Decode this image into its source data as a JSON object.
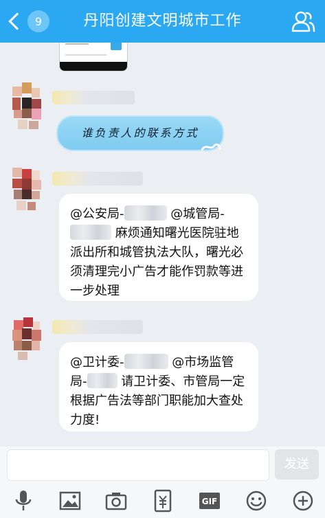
{
  "header": {
    "title": "丹阳创建文明城市工作",
    "unread_count": "9",
    "group_icon": "group-members-icon",
    "back_icon": "back-arrow-icon"
  },
  "messages": [
    {
      "type": "blue-bubble",
      "text": "谁负责人的联系方式"
    },
    {
      "type": "text",
      "parts": {
        "mention1": "@公安局-",
        "mention2": "@城管局-",
        "body": "麻烦通知曙光医院驻地派出所和城管执法大队，曙光必须清理完小广告才能作罚款等进一步处理"
      }
    },
    {
      "type": "text",
      "parts": {
        "mention1": "@卫计委-",
        "mention2": "@市场监管局-",
        "body": "请卫计委、市管局一定根据广告法等部门职能加大查处力度!"
      }
    }
  ],
  "composer": {
    "send_label": "发送"
  },
  "toolbar": {
    "items": [
      "microphone-icon",
      "image-icon",
      "camera-icon",
      "red-packet-icon",
      "gif-icon",
      "emoji-icon",
      "plus-icon"
    ],
    "gif_label": "GIF"
  },
  "colors": {
    "header": "#2aa8f2",
    "background": "#ebeff4",
    "bubble": "#ffffff",
    "blue_bubble": "#8fd3f4"
  }
}
